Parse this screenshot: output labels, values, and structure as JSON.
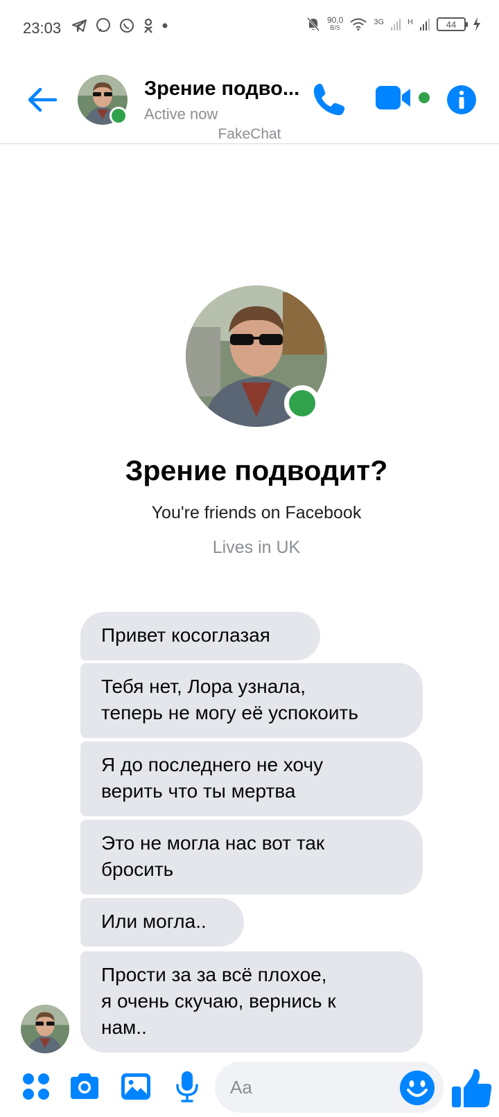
{
  "status_bar": {
    "time": "23:03",
    "net_speed_value": "90,0",
    "net_speed_unit": "B/S",
    "network_3g": "3G",
    "network_h": "H",
    "battery": "44"
  },
  "header": {
    "contact_name": "Зрение подво...",
    "presence": "Active now",
    "watermark": "FakeChat"
  },
  "profile": {
    "name": "Зрение подводит?",
    "friends_text": "You're friends on Facebook",
    "location_text": "Lives in UK"
  },
  "messages": [
    {
      "text": "Привет косоглазая"
    },
    {
      "text": "Тебя нет, Лора узнала,\nтеперь не могу её успокоить"
    },
    {
      "text": "Я до последнего не хочу\nверить что ты мертва"
    },
    {
      "text": "Это не могла нас вот так\nбросить"
    },
    {
      "text": "Или могла.."
    },
    {
      "text": "Прости за за всё плохое,\nя очень скучаю, вернись к\nнам.."
    }
  ],
  "composer": {
    "placeholder": "Aa"
  },
  "colors": {
    "accent": "#0084ff",
    "online": "#31a24c",
    "bubble": "#e4e6eb"
  },
  "icons": [
    "back-arrow-icon",
    "phone-icon",
    "video-camera-icon",
    "info-icon",
    "more-dots-icon",
    "camera-icon",
    "gallery-icon",
    "microphone-icon",
    "emoji-icon",
    "thumbs-up-icon"
  ]
}
